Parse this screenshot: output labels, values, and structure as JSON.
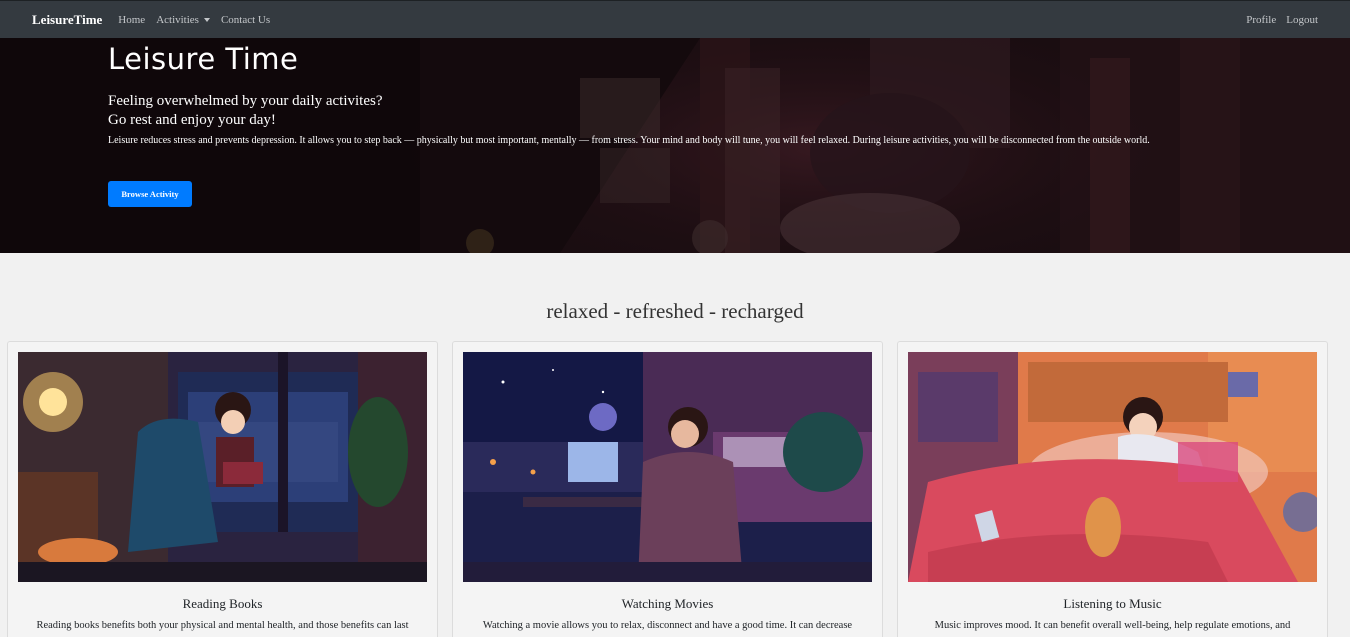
{
  "navbar": {
    "brand": "LeisureTime",
    "links": {
      "home": "Home",
      "activities": "Activities",
      "contact": "Contact Us"
    },
    "right": {
      "profile": "Profile",
      "logout": "Logout"
    }
  },
  "hero": {
    "title": "Leisure Time",
    "subtitle_line1": "Feeling overwhelmed by your daily activites?",
    "subtitle_line2": "Go rest and enjoy your day!",
    "description": "Leisure reduces stress and prevents depression. It allows you to step back — physically but most important, mentally — from stress. Your mind and body will tune, you will feel relaxed. During leisure activities, you will be disconnected from the outside world.",
    "button": "Browse Activity"
  },
  "tagline": "relaxed - refreshed - recharged",
  "cards": [
    {
      "title": "Reading Books",
      "text": "Reading books benefits both your physical and mental health, and those benefits can last"
    },
    {
      "title": "Watching Movies",
      "text": "Watching a movie allows you to relax, disconnect and have a good time. It can decrease"
    },
    {
      "title": "Listening to Music",
      "text": "Music improves mood. It can benefit overall well-being, help regulate emotions, and"
    }
  ],
  "colors": {
    "navbar": "#343a40",
    "accent": "#007bff",
    "page_bg": "#f1f1f1"
  }
}
